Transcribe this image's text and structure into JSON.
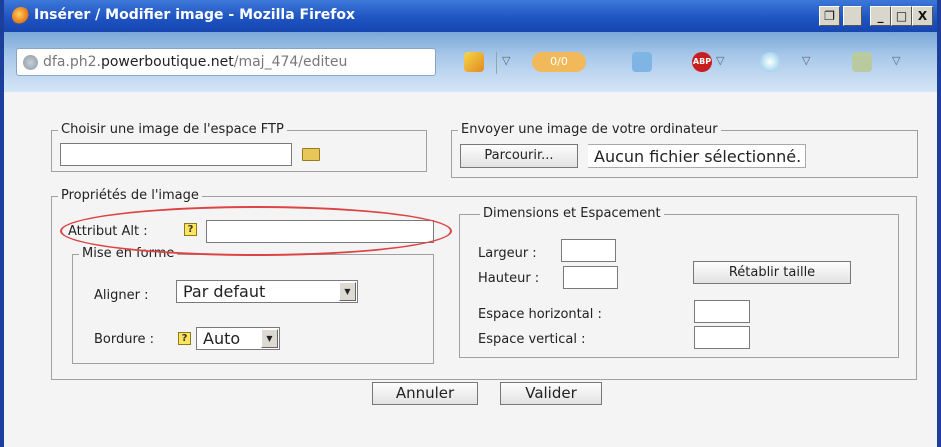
{
  "window": {
    "title": "Insérer / Modifier image - Mozilla Firefox",
    "controls": {
      "restore_label": "❐",
      "minimize_label": "_",
      "maximize_label": "□",
      "close_label": "X"
    }
  },
  "address_bar": {
    "url_prefix": "dfa.ph2.",
    "url_domain": "powerboutique.net",
    "url_path": "/maj_474/editeu",
    "toolbar_icons": [
      "pencil-icon",
      "addon-counter-icon",
      "grid-icon",
      "adblock-icon",
      "globe-icon",
      "tools-icon"
    ],
    "addon_counter": "0/0",
    "adblock_label": "ABP"
  },
  "ftp_section": {
    "legend": "Choisir une image de l'espace FTP",
    "path_value": "",
    "browse_icon": "folder-open-icon"
  },
  "upload_section": {
    "legend": "Envoyer une image de votre ordinateur",
    "browse_button": "Parcourir...",
    "no_file_text": "Aucun fichier sélectionné."
  },
  "properties": {
    "legend": "Propriétés de l'image",
    "alt_label": "Attribut Alt :",
    "alt_value": "",
    "help_glyph": "?",
    "format": {
      "legend": "Mise en forme",
      "align_label": "Aligner :",
      "align_value": "Par defaut",
      "border_label": "Bordure :",
      "border_value": "Auto"
    },
    "dimensions": {
      "legend": "Dimensions et Espacement",
      "width_label": "Largeur :",
      "height_label": "Hauteur :",
      "reset_button": "Rétablir taille",
      "hspace_label": "Espace horizontal :",
      "vspace_label": "Espace vertical :"
    }
  },
  "actions": {
    "cancel_button": "Annuler",
    "ok_button": "Valider"
  },
  "colors": {
    "titlebar": "#1d52c0",
    "highlight_ellipse": "#d44444",
    "help_icon": "#ffe45c"
  }
}
